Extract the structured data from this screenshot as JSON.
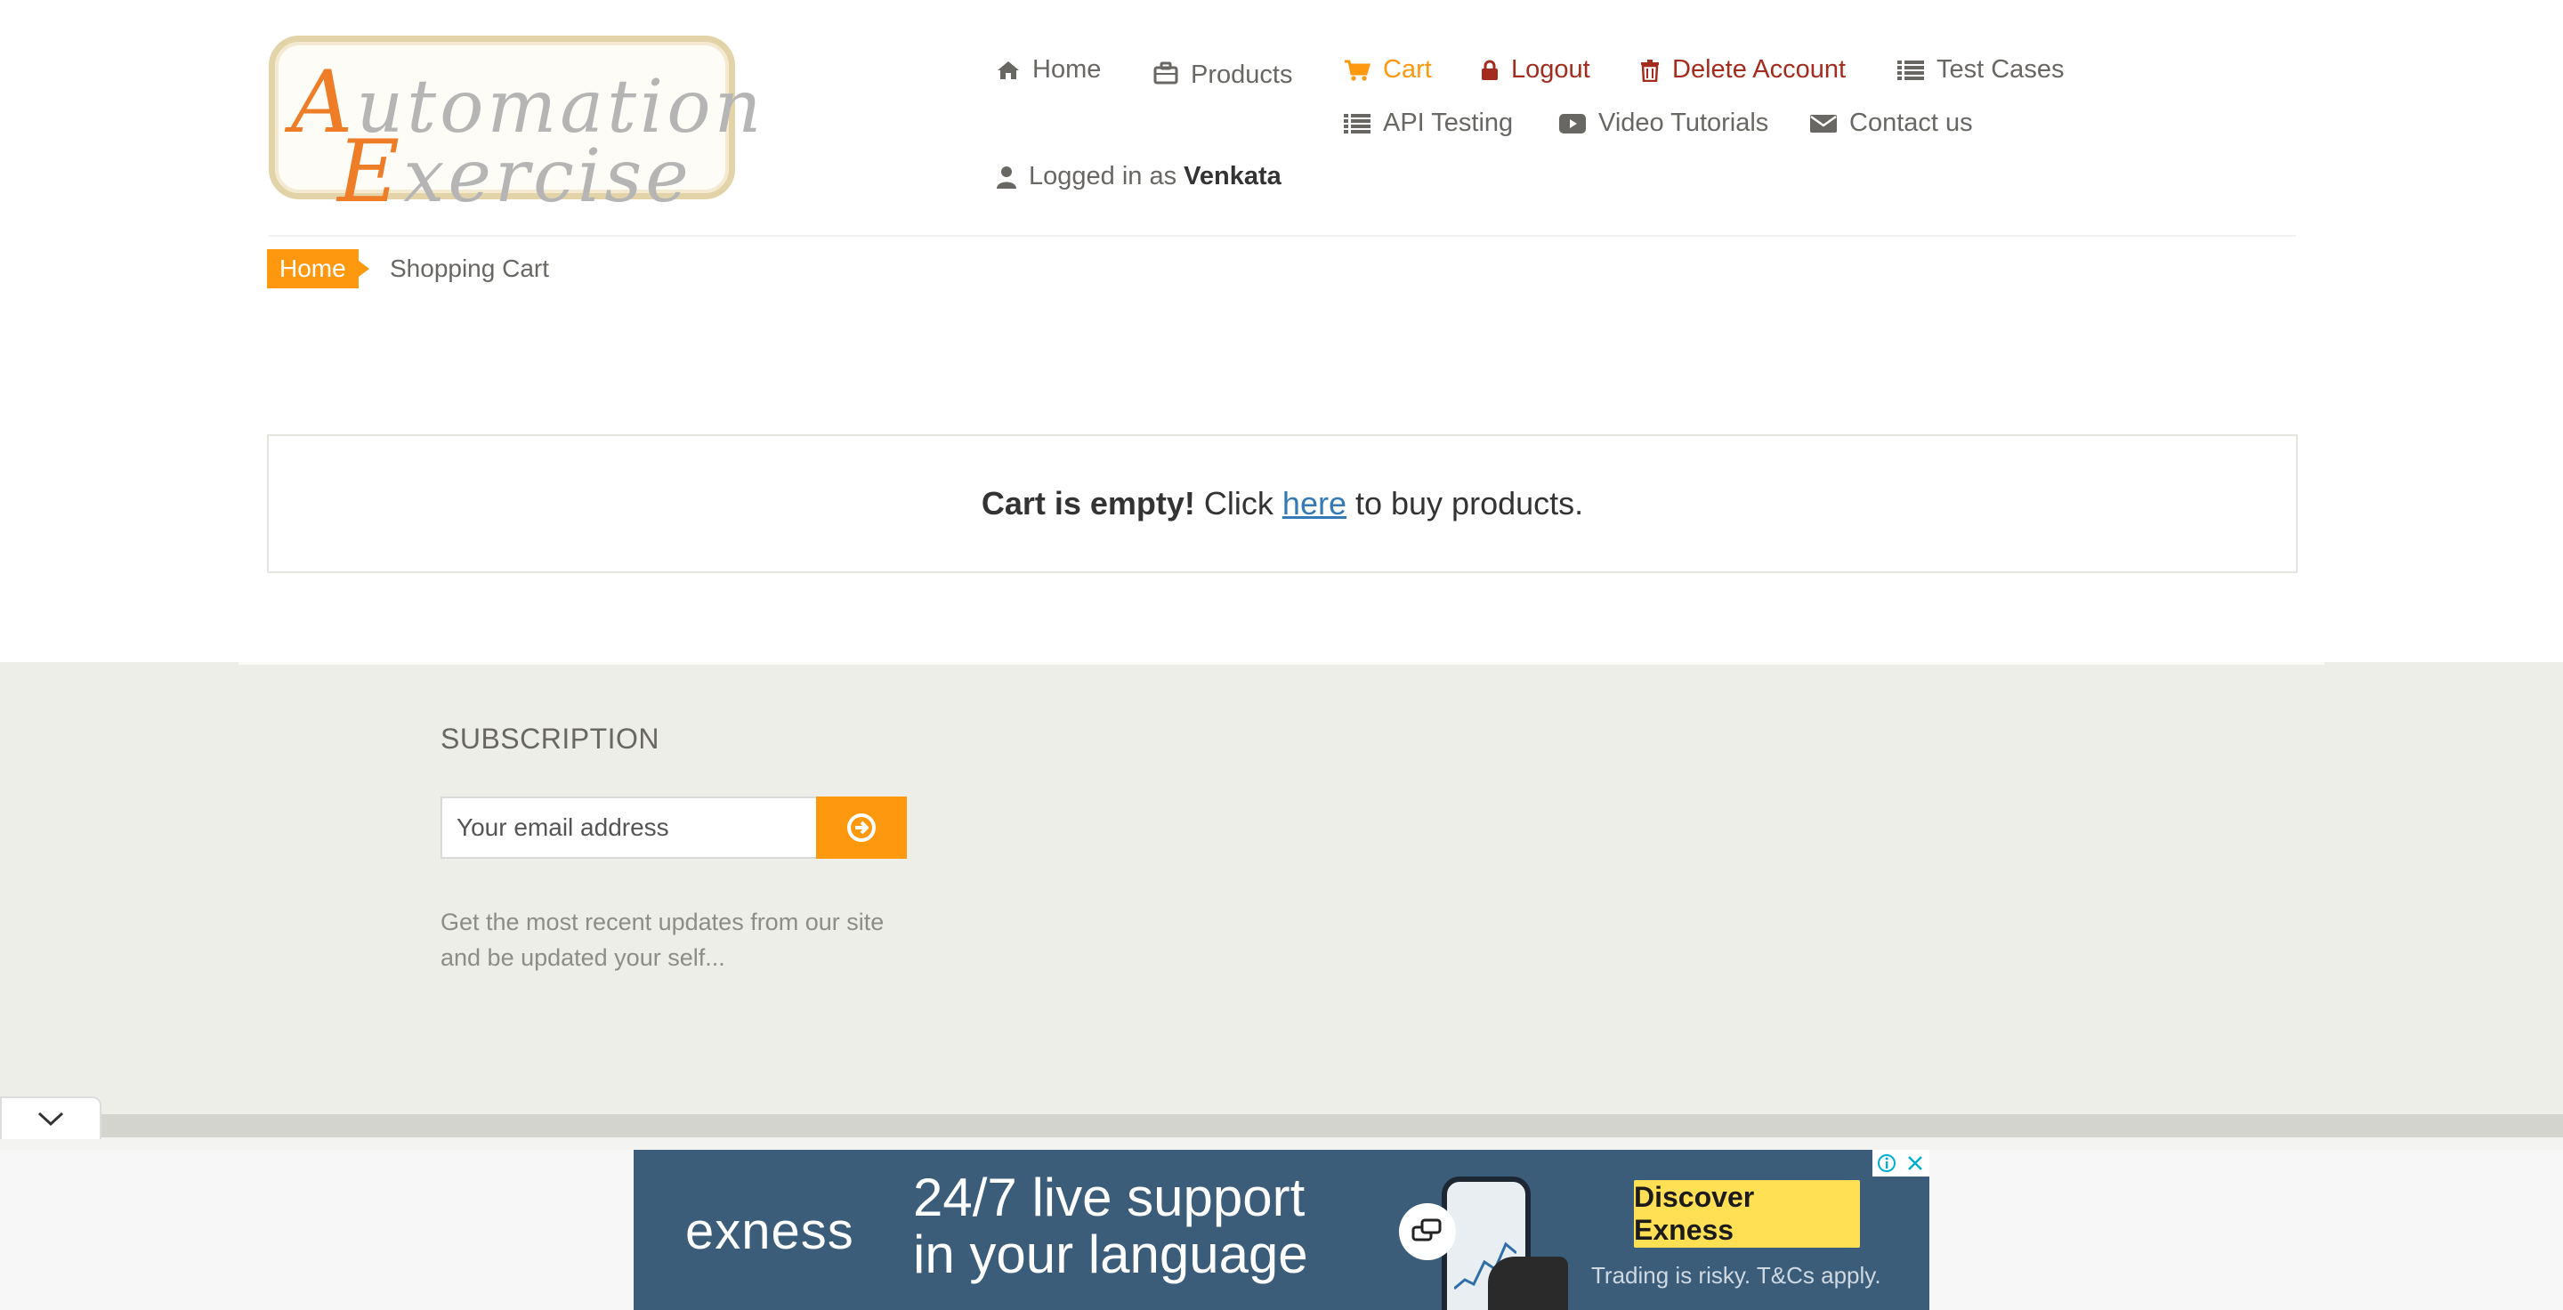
{
  "logo": {
    "line1_initial": "A",
    "line1_rest": "utomation",
    "line2_initial": "E",
    "line2_rest": "xercise"
  },
  "nav": {
    "home": "Home",
    "products": "Products",
    "cart": "Cart",
    "logout": "Logout",
    "delete_account": "Delete Account",
    "test_cases": "Test Cases",
    "api_testing": "API Testing",
    "video_tutorials": "Video Tutorials",
    "contact_us": "Contact us",
    "logged_in_prefix": "Logged in as",
    "logged_in_user": "Venkata"
  },
  "breadcrumb": {
    "home": "Home",
    "current": "Shopping Cart"
  },
  "cart": {
    "empty_bold": "Cart is empty!",
    "empty_pre": "Click",
    "empty_link": "here",
    "empty_post": "to buy products."
  },
  "footer": {
    "subscription_title": "SUBSCRIPTION",
    "email_placeholder": "Your email address",
    "description": "Get the most recent updates from our site and be updated your self..."
  },
  "ad": {
    "brand": "exness",
    "headline_line1": "24/7 live support",
    "headline_line2": "in your language",
    "cta": "Discover Exness",
    "disclaimer": "Trading is risky. T&Cs apply."
  },
  "colors": {
    "accent": "#fe980f",
    "danger": "#a32c1e",
    "link": "#337ab7",
    "footer_bg": "#eeeee8",
    "ad_bg": "#3b5d7a",
    "ad_cta": "#ffe055"
  }
}
